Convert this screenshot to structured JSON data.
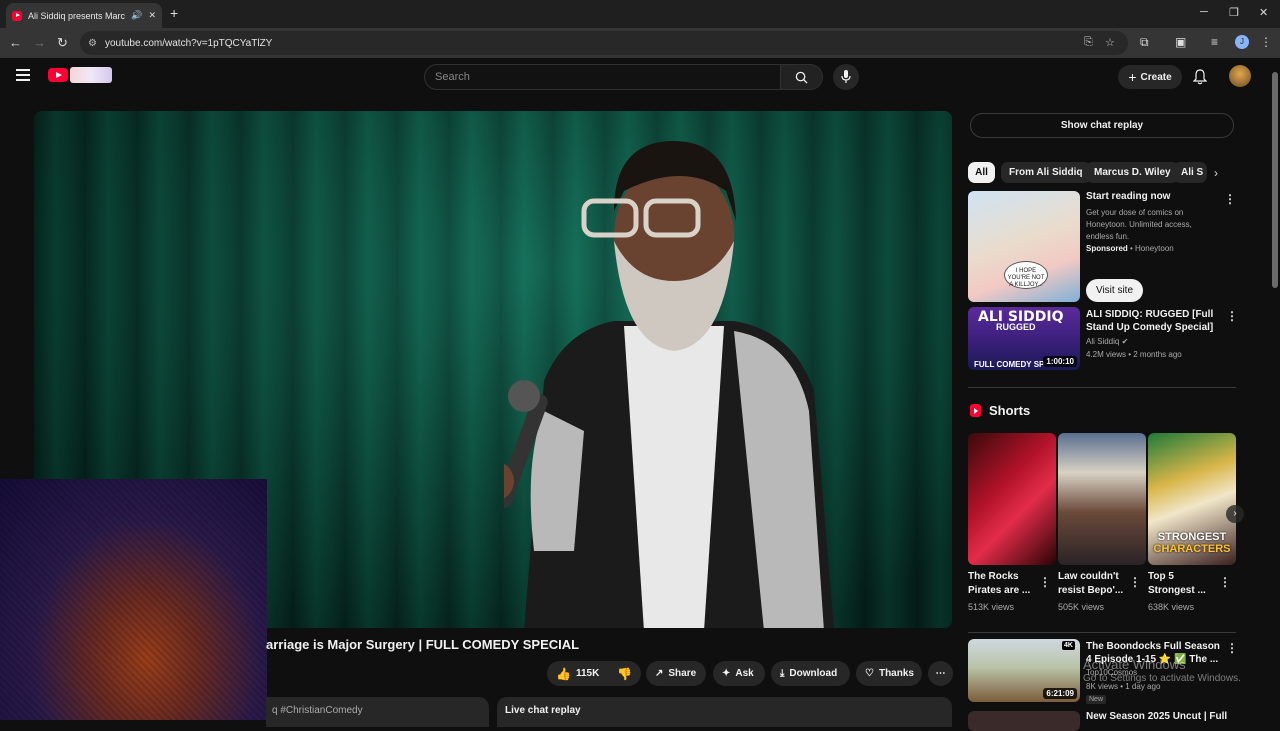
{
  "browser": {
    "tab_title": "Ali Siddiq presents Marcus",
    "url": "youtube.com/watch?v=1pTQCYaTlZY",
    "profile_initial": "J"
  },
  "header": {
    "search_placeholder": "Search",
    "create_label": "Create"
  },
  "video": {
    "title": "arriage is Major Surgery | FULL COMEDY SPECIAL",
    "likes": "115K",
    "share_label": "Share",
    "ask_label": "Ask",
    "download_label": "Download",
    "thanks_label": "Thanks",
    "description_snippet": "q #ChristianComedy",
    "live_chat_label": "Live chat replay"
  },
  "sidebar": {
    "show_chat_replay": "Show chat replay",
    "chips": [
      "All",
      "From Ali Siddiq",
      "Marcus D. Wiley",
      "Ali S"
    ],
    "ad": {
      "title": "Start reading now",
      "description": "Get your dose of comics on Honeytoon. Unlimited access, endless fun.",
      "sponsored": "Sponsored",
      "advertiser": "Honeytoon",
      "visit_label": "Visit site",
      "bubble_text": "I HOPE YOU'RE NOT A KILLJOY..."
    },
    "rec1": {
      "thumb_line1": "ALI SIDDIQ",
      "thumb_line2": "RUGGED",
      "thumb_line3": "FULL COMEDY SP",
      "duration": "1:00:10",
      "title": "ALI SIDDIQ: RUGGED [Full Stand Up Comedy Special]",
      "channel": "Ali Siddiq",
      "meta": "4.2M views • 2 months ago"
    },
    "shorts_heading": "Shorts",
    "shorts": [
      {
        "title": "The Rocks Pirates are ...",
        "views": "513K views"
      },
      {
        "title": "Law couldn't resist Bepo'...",
        "views": "505K views"
      },
      {
        "title": "Top 5 Strongest ...",
        "views": "638K views"
      }
    ],
    "short3_overlay": [
      "STRONGEST",
      "CHARACTERS"
    ],
    "rec2": {
      "badge": "4K",
      "duration": "6:21:09",
      "title": "The Boondocks Full Season 4 Episode 1-15 ⭐ ✅ The ...",
      "channel": "Top10Cosmos",
      "meta": "8K views • 1 day ago",
      "new_badge": "New"
    },
    "rec3": {
      "title": "New Season 2025 Uncut | Full"
    }
  },
  "watermark": {
    "line1": "Activate Windows",
    "line2": "Go to Settings to activate Windows."
  }
}
